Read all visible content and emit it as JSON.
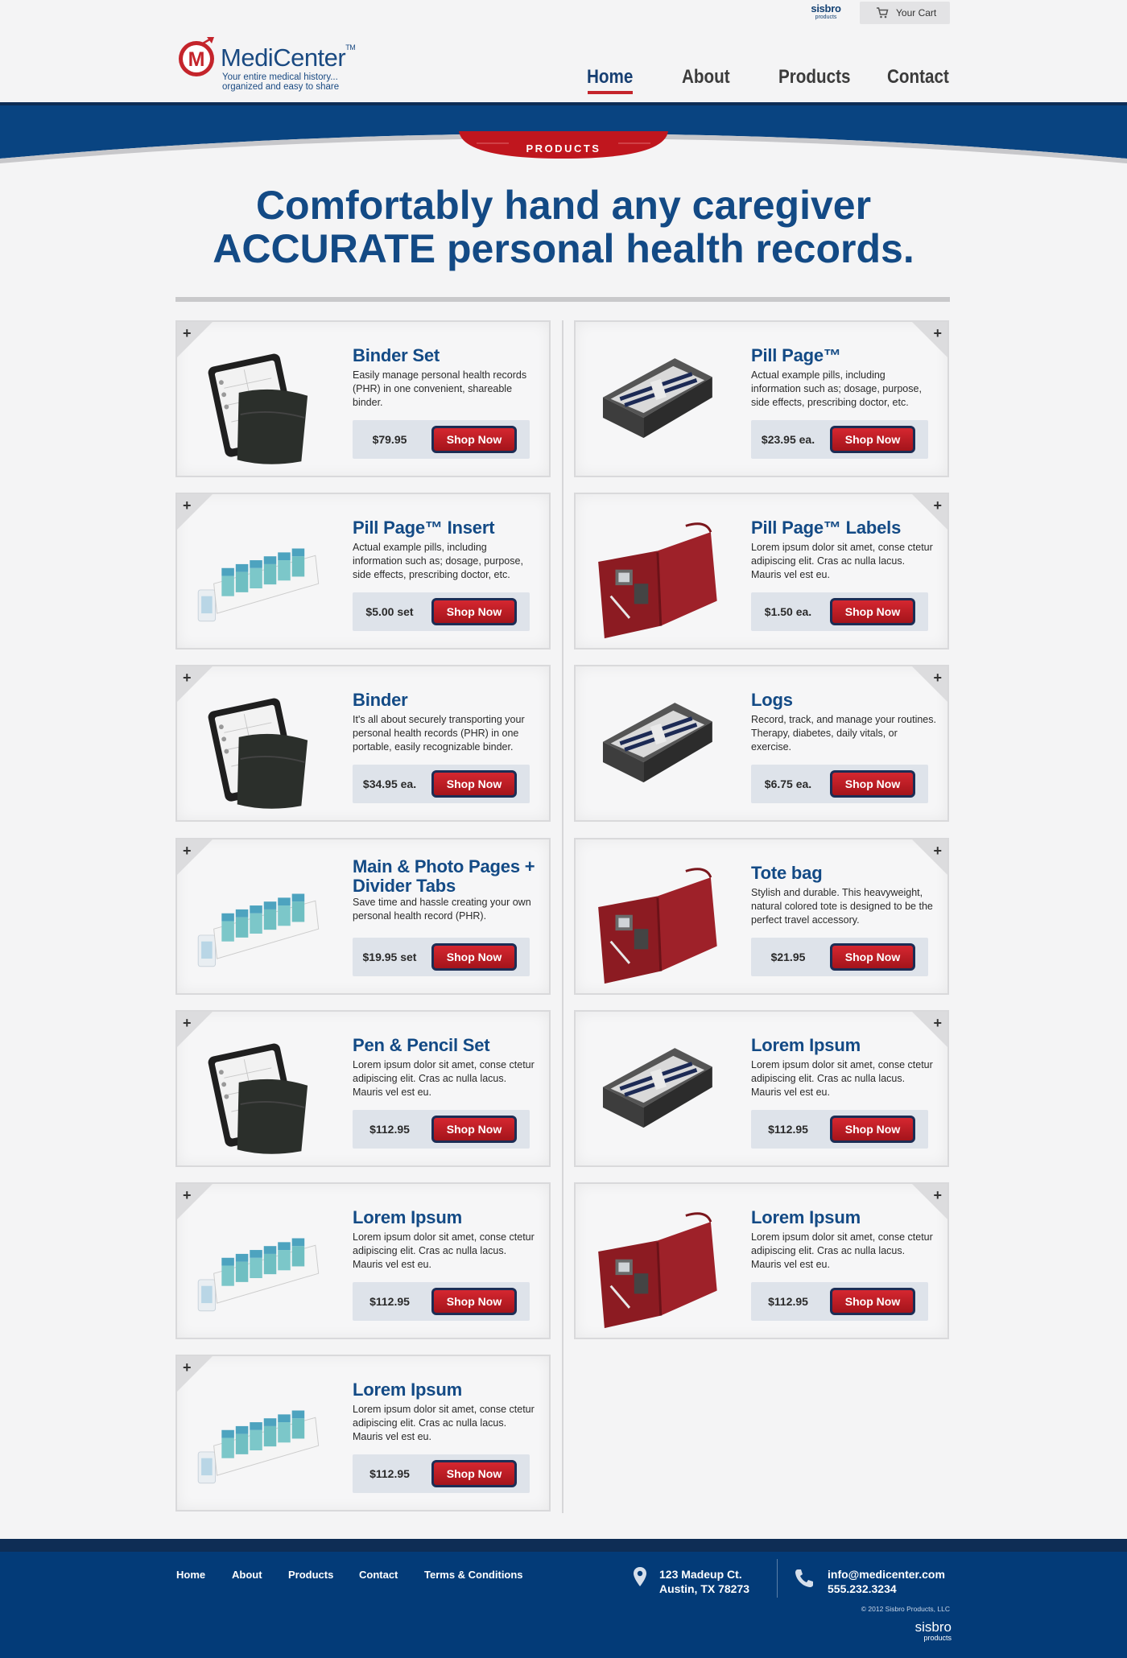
{
  "header": {
    "cart_label": "Your Cart",
    "sisbro_name": "sisbro",
    "sisbro_sub": "products",
    "logo_name": "MediCenter",
    "logo_tm": "TM",
    "logo_tag_line1": "Your entire medical history...",
    "logo_tag_line2": "organized and easy to share",
    "nav": [
      "Home",
      "About",
      "Products",
      "Contact"
    ],
    "active_nav": "Home",
    "section_tab": "PRODUCTS"
  },
  "hero": {
    "line1": "Comfortably hand any caregiver",
    "line2": "ACCURATE personal health records."
  },
  "products": [
    {
      "title": "Binder Set",
      "desc": "Easily manage personal health records (PHR) in one convenient, shareable binder.",
      "price": "$79.95",
      "image": "binder-icon"
    },
    {
      "title": "Pill Page™",
      "desc": "Actual example pills, including information such as; dosage, purpose, side effects, prescribing doctor, etc.",
      "price": "$23.95 ea.",
      "image": "pen-case-icon"
    },
    {
      "title": "Pill Page™ Insert",
      "desc": "Actual example pills, including information such as; dosage, purpose, side effects, prescribing doctor, etc.",
      "price": "$5.00 set",
      "image": "pill-organizer-icon"
    },
    {
      "title": "Pill Page™ Labels",
      "desc": "Lorem ipsum dolor sit amet, conse ctetur adipiscing elit. Cras ac nulla lacus. Mauris vel est eu.",
      "price": "$1.50 ea.",
      "image": "red-portfolio-icon"
    },
    {
      "title": "Binder",
      "desc": "It's all about securely transporting your personal health records (PHR) in one portable, easily recognizable binder.",
      "price": "$34.95 ea.",
      "image": "binder-icon"
    },
    {
      "title": "Logs",
      "desc": "Record, track, and manage your routines. Therapy, diabetes, daily vitals, or exercise.",
      "price": "$6.75 ea.",
      "image": "pen-case-icon"
    },
    {
      "title": "Main & Photo Pages + Divider Tabs",
      "desc": "Save time and hassle creating your own personal health record (PHR).",
      "price": "$19.95 set",
      "image": "pill-organizer-icon"
    },
    {
      "title": "Tote bag",
      "desc": "Stylish and durable. This heavyweight, natural colored tote is designed to be the perfect travel accessory.",
      "price": "$21.95",
      "image": "red-portfolio-icon"
    },
    {
      "title": "Pen & Pencil Set",
      "desc": "Lorem ipsum dolor sit amet, conse ctetur adipiscing elit. Cras ac nulla lacus. Mauris vel est eu.",
      "price": "$112.95",
      "image": "binder-icon"
    },
    {
      "title": "Lorem Ipsum",
      "desc": "Lorem ipsum dolor sit amet, conse ctetur adipiscing elit. Cras ac nulla lacus. Mauris vel est eu.",
      "price": "$112.95",
      "image": "pen-case-icon"
    },
    {
      "title": "Lorem Ipsum",
      "desc": "Lorem ipsum dolor sit amet, conse ctetur adipiscing elit. Cras ac nulla lacus. Mauris vel est eu.",
      "price": "$112.95",
      "image": "pill-organizer-icon"
    },
    {
      "title": "Lorem Ipsum",
      "desc": "Lorem ipsum dolor sit amet, conse ctetur adipiscing elit. Cras ac nulla lacus. Mauris vel est eu.",
      "price": "$112.95",
      "image": "red-portfolio-icon"
    },
    {
      "title": "Lorem Ipsum",
      "desc": "Lorem ipsum dolor sit amet, conse ctetur adipiscing elit. Cras ac nulla lacus. Mauris vel est eu.",
      "price": "$112.95",
      "image": "pill-organizer-icon"
    }
  ],
  "shop_label": "Shop Now",
  "footer": {
    "links": [
      "Home",
      "About",
      "Products",
      "Contact",
      "Terms & Conditions"
    ],
    "address_line1": "123 Madeup Ct.",
    "address_line2": "Austin, TX 78273",
    "email": "info@medicenter.com",
    "phone": "555.232.3234",
    "copyright": "© 2012 Sisbro Products, LLC",
    "sisbro_name": "sisbro",
    "sisbro_sub": "products"
  },
  "colors": {
    "brand_blue": "#134a85",
    "accent_red": "#c4242b",
    "footer_blue": "#033b78"
  }
}
